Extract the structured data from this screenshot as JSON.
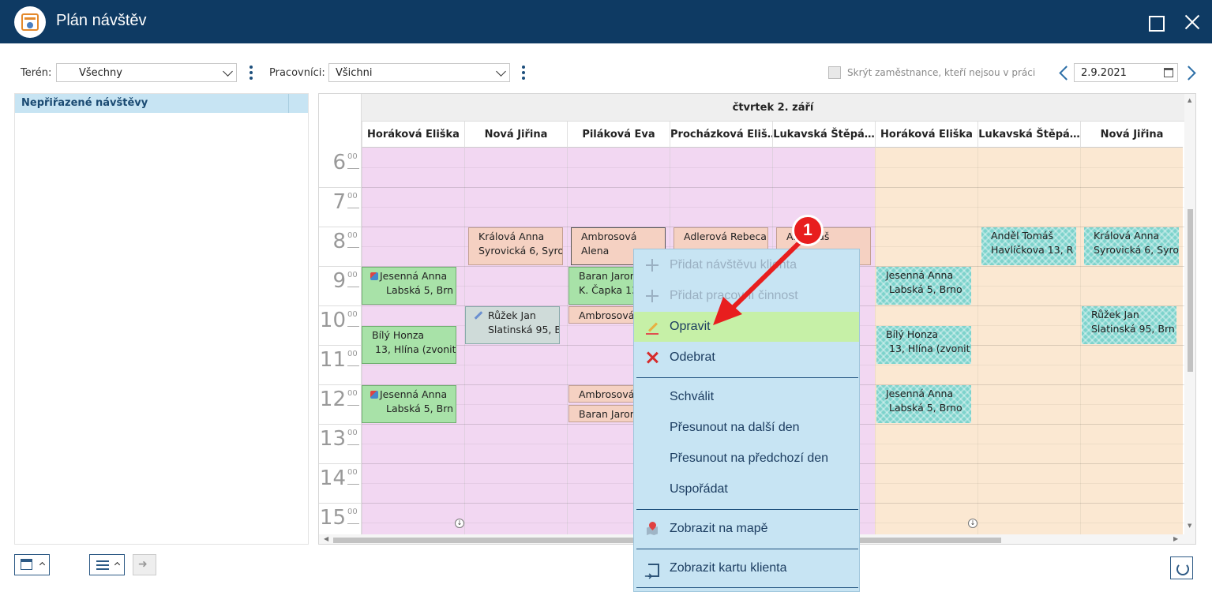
{
  "window": {
    "title": "Plán návštěv"
  },
  "filters": {
    "teren_label": "Terén:",
    "teren_value": "Všechny",
    "pracovnici_label": "Pracovníci:",
    "pracovnici_value": "Všichni",
    "hide_label": "Skrýt zaměstnance, kteří nejsou v práci",
    "date": "2.9.2021"
  },
  "left_panel": {
    "header": "Nepřiřazené návštěvy"
  },
  "calendar": {
    "day_header": "čtvrtek 2. září",
    "columns": [
      "Horáková Eliška",
      "Nová Jiřina",
      "Piláková Eva",
      "Procházková Eliš…",
      "Lukavská Štěpá…",
      "Horáková Eliška",
      "Lukavská Štěpá…",
      "Nová Jiřina"
    ],
    "hours": [
      "6",
      "7",
      "8",
      "9",
      "10",
      "11",
      "12",
      "13",
      "14",
      "15"
    ],
    "minutes": "00",
    "events": [
      {
        "line1": "Králová Anna",
        "line2": "Syrovická 6, Syro"
      },
      {
        "line1": "Ambrosová",
        "line2": "Alena"
      },
      {
        "line1": "Adlerová Rebeca",
        "line2": ""
      },
      {
        "line1": "An    omáš",
        "line2": ""
      },
      {
        "line1": "Anděl Tomáš",
        "line2": "Havlíčkova 13, R"
      },
      {
        "line1": "Králová Anna",
        "line2": "Syrovická 6, Syro"
      },
      {
        "line1": "Jesenná Anna",
        "line2": "Labská 5, Brn"
      },
      {
        "line1": "Baran Jarom",
        "line2": "K. Čapka 13"
      },
      {
        "line1": "Jesenná Anna",
        "line2": "Labská 5, Brno"
      },
      {
        "line1": "Růžek Jan",
        "line2": "Slatinská 95, B"
      },
      {
        "line1": "Ambrosová",
        "line2": ""
      },
      {
        "line1": "Růžek Jan",
        "line2": "Slatinská 95, Brn"
      },
      {
        "line1": "Bílý Honza",
        "line2": "13, Hlína (zvonit"
      },
      {
        "line1": "Bílý Honza",
        "line2": "13, Hlína (zvonit"
      },
      {
        "line1": "Jesenná Anna",
        "line2": "Labská 5, Brn"
      },
      {
        "line1": "Ambrosová",
        "line2": ""
      },
      {
        "line1": "Jesenná Anna",
        "line2": "Labská 5, Brno"
      },
      {
        "line1": "Baran Jarom",
        "line2": ""
      }
    ]
  },
  "context_menu": {
    "items": [
      {
        "label": "Přidat návštěvu klienta",
        "icon": "plus-icon",
        "disabled": true
      },
      {
        "label": "Přidat pracovní činnost",
        "icon": "plus-icon",
        "disabled": true
      },
      {
        "label": "Opravit",
        "icon": "pencil-icon",
        "highlighted": true
      },
      {
        "label": "Odebrat",
        "icon": "delete-icon"
      },
      {
        "label": "Schválit"
      },
      {
        "label": "Přesunout na další den"
      },
      {
        "label": "Přesunout na předchozí den"
      },
      {
        "label": "Uspořádat"
      },
      {
        "label": "Zobrazit na mapě",
        "icon": "map-icon"
      },
      {
        "label": "Zobrazit kartu klienta",
        "icon": "client-card-icon"
      }
    ]
  },
  "annotation": {
    "badge": "1"
  },
  "colors": {
    "titlebar": "#0e3a63",
    "menu_bg": "#c7e4f3",
    "menu_highlight": "#c6f0a7",
    "column_pink": "#f2d7f2",
    "column_peach": "#fbe8d2",
    "event_teal": "#7dd3cc",
    "event_green": "#a8e2a8",
    "event_salmon": "#f5d1c2",
    "annotation_red": "#e81e1e"
  }
}
